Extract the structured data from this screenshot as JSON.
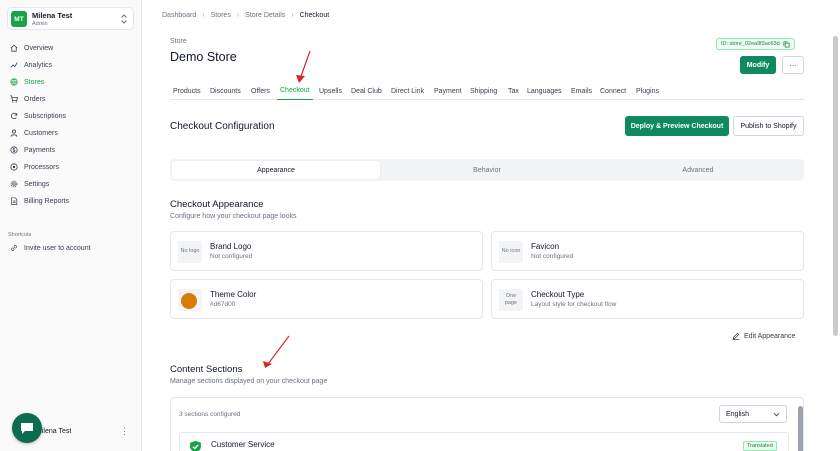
{
  "account": {
    "initials": "MT",
    "name": "Milena Test",
    "role": "Admin"
  },
  "sidebar": {
    "items": [
      {
        "label": "Overview",
        "icon": "home-icon"
      },
      {
        "label": "Analytics",
        "icon": "chart-icon"
      },
      {
        "label": "Stores",
        "icon": "globe-icon",
        "active": true
      },
      {
        "label": "Orders",
        "icon": "cart-icon"
      },
      {
        "label": "Subscriptions",
        "icon": "refresh-icon"
      },
      {
        "label": "Customers",
        "icon": "user-icon"
      },
      {
        "label": "Payments",
        "icon": "dollar-icon"
      },
      {
        "label": "Processors",
        "icon": "processor-icon"
      },
      {
        "label": "Settings",
        "icon": "gear-icon"
      },
      {
        "label": "Billing Reports",
        "icon": "document-icon"
      }
    ],
    "shortcuts_label": "Shortcuts",
    "invite_label": "Invite user to account",
    "footer_user": "Milena Test"
  },
  "breadcrumb": [
    "Dashboard",
    "Stores",
    "Store Details",
    "Checkout"
  ],
  "header": {
    "store_label": "Store",
    "store_name": "Demo Store",
    "store_id": "ID: store_02ea9f3ac63d",
    "modify_label": "Modify",
    "more_label": "···"
  },
  "tabs": [
    "Products",
    "Discounts",
    "Offers",
    "Checkout",
    "Upsells",
    "Deal Club",
    "Direct Link",
    "Payment",
    "Shipping",
    "Tax",
    "Languages",
    "Emails",
    "Connect",
    "Plugins"
  ],
  "active_tab": "Checkout",
  "config": {
    "title": "Checkout Configuration",
    "deploy_label": "Deploy & Preview Checkout",
    "publish_label": "Publish to Shopify",
    "segments": [
      "Appearance",
      "Behavior",
      "Advanced"
    ]
  },
  "appearance": {
    "title": "Checkout Appearance",
    "description": "Configure how your checkout page looks",
    "cards": {
      "brand_logo": {
        "thumb": "No logo",
        "title": "Brand Logo",
        "sub": "Not configured"
      },
      "favicon": {
        "thumb": "No icon",
        "title": "Favicon",
        "sub": "Not configured"
      },
      "theme_color": {
        "title": "Theme Color",
        "sub": "#d67d00",
        "color": "#d67d00"
      },
      "checkout_type": {
        "thumb": "One page",
        "title": "Checkout Type",
        "sub": "Layout style for checkout flow"
      }
    },
    "edit_label": "Edit Appearance"
  },
  "content": {
    "title": "Content Sections",
    "description": "Manage sections displayed on your checkout page",
    "count": "3 sections configured",
    "language": "English",
    "section": {
      "name": "Customer Service",
      "badge": "Translated"
    }
  }
}
